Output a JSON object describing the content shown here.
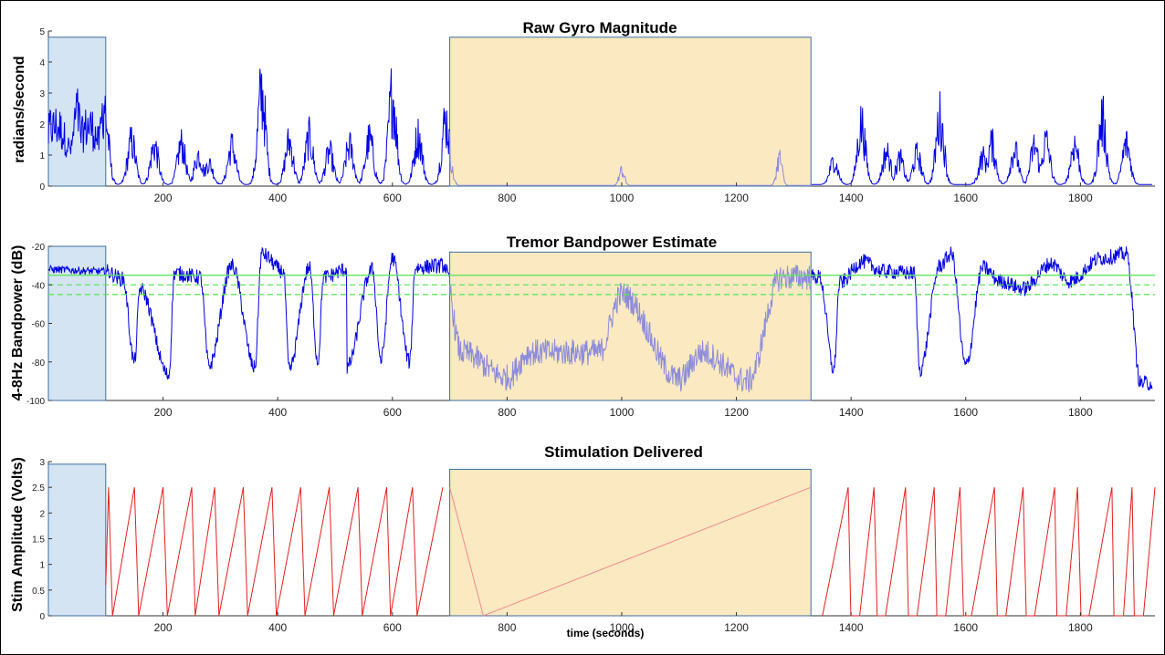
{
  "chart_data": [
    {
      "type": "line",
      "title": "Raw Gyro Magnitude",
      "xlabel": "",
      "ylabel": "radians/second",
      "xlim": [
        0,
        1930
      ],
      "ylim": [
        0,
        5
      ],
      "xticks": [
        200,
        400,
        600,
        800,
        1000,
        1200,
        1400,
        1600,
        1800
      ],
      "yticks": [
        0,
        1,
        2,
        3,
        4,
        5
      ],
      "line_color": "#0000e6",
      "shaded_regions": [
        {
          "x": [
            0,
            100
          ],
          "y": [
            0,
            4.8
          ],
          "color": "#d5e4f2"
        },
        {
          "x": [
            700,
            1330
          ],
          "y": [
            0,
            4.8
          ],
          "color": "#fbe9c1"
        }
      ],
      "peaks": [
        {
          "x": 5,
          "y": 2.2
        },
        {
          "x": 50,
          "y": 2.8
        },
        {
          "x": 98,
          "y": 3.3
        },
        {
          "x": 145,
          "y": 2.0
        },
        {
          "x": 185,
          "y": 1.8
        },
        {
          "x": 232,
          "y": 1.9
        },
        {
          "x": 262,
          "y": 1.4
        },
        {
          "x": 280,
          "y": 1.0
        },
        {
          "x": 320,
          "y": 1.8
        },
        {
          "x": 372,
          "y": 4.3
        },
        {
          "x": 420,
          "y": 2.0
        },
        {
          "x": 455,
          "y": 2.2
        },
        {
          "x": 490,
          "y": 1.5
        },
        {
          "x": 525,
          "y": 1.8
        },
        {
          "x": 560,
          "y": 2.1
        },
        {
          "x": 600,
          "y": 4.2
        },
        {
          "x": 645,
          "y": 2.3
        },
        {
          "x": 693,
          "y": 3.0
        },
        {
          "x": 1000,
          "y": 0.7
        },
        {
          "x": 1275,
          "y": 1.3
        },
        {
          "x": 1370,
          "y": 1.1
        },
        {
          "x": 1418,
          "y": 2.8
        },
        {
          "x": 1462,
          "y": 1.5
        },
        {
          "x": 1485,
          "y": 1.2
        },
        {
          "x": 1515,
          "y": 1.4
        },
        {
          "x": 1555,
          "y": 3.1
        },
        {
          "x": 1630,
          "y": 1.3
        },
        {
          "x": 1645,
          "y": 1.9
        },
        {
          "x": 1685,
          "y": 1.6
        },
        {
          "x": 1720,
          "y": 1.8
        },
        {
          "x": 1740,
          "y": 2.0
        },
        {
          "x": 1790,
          "y": 1.9
        },
        {
          "x": 1838,
          "y": 3.0
        },
        {
          "x": 1880,
          "y": 1.9
        }
      ]
    },
    {
      "type": "line",
      "title": "Tremor Bandpower Estimate",
      "xlabel": "",
      "ylabel": "4-8Hz Bandpower (dB)",
      "xlim": [
        0,
        1930
      ],
      "ylim": [
        -100,
        -20
      ],
      "xticks": [
        200,
        400,
        600,
        800,
        1000,
        1200,
        1400,
        1600,
        1800
      ],
      "yticks": [
        -100,
        -80,
        -60,
        -40,
        -20
      ],
      "line_color": "#0000e6",
      "threshold_lines": [
        {
          "y": -35,
          "style": "solid",
          "color": "#5ee65e"
        },
        {
          "y": -40,
          "style": "dashed",
          "color": "#5ee65e"
        },
        {
          "y": -45,
          "style": "dashed",
          "color": "#5ee65e"
        }
      ],
      "shaded_regions": [
        {
          "x": [
            0,
            100
          ],
          "y": [
            -100,
            -20
          ],
          "color": "#d5e4f2"
        },
        {
          "x": [
            700,
            1330
          ],
          "y": [
            -100,
            -23
          ],
          "color": "#fbe9c1"
        }
      ],
      "peaks": [
        {
          "x": 0,
          "y": -32
        },
        {
          "x": 100,
          "y": -33
        },
        {
          "x": 130,
          "y": -37
        },
        {
          "x": 160,
          "y": -42
        },
        {
          "x": 220,
          "y": -34
        },
        {
          "x": 265,
          "y": -36
        },
        {
          "x": 320,
          "y": -30
        },
        {
          "x": 372,
          "y": -24
        },
        {
          "x": 410,
          "y": -33
        },
        {
          "x": 455,
          "y": -31
        },
        {
          "x": 480,
          "y": -36
        },
        {
          "x": 520,
          "y": -32
        },
        {
          "x": 565,
          "y": -32
        },
        {
          "x": 600,
          "y": -26
        },
        {
          "x": 640,
          "y": -31
        },
        {
          "x": 690,
          "y": -30
        },
        {
          "x": 1000,
          "y": -45
        },
        {
          "x": 1278,
          "y": -36
        },
        {
          "x": 1345,
          "y": -36
        },
        {
          "x": 1380,
          "y": -39
        },
        {
          "x": 1420,
          "y": -28
        },
        {
          "x": 1455,
          "y": -33
        },
        {
          "x": 1510,
          "y": -34
        },
        {
          "x": 1555,
          "y": -30
        },
        {
          "x": 1575,
          "y": -24
        },
        {
          "x": 1630,
          "y": -31
        },
        {
          "x": 1660,
          "y": -38
        },
        {
          "x": 1700,
          "y": -42
        },
        {
          "x": 1750,
          "y": -29
        },
        {
          "x": 1780,
          "y": -38
        },
        {
          "x": 1838,
          "y": -26
        },
        {
          "x": 1880,
          "y": -24
        }
      ],
      "troughs": [
        {
          "x": 150,
          "y": -80
        },
        {
          "x": 210,
          "y": -87
        },
        {
          "x": 280,
          "y": -82
        },
        {
          "x": 360,
          "y": -83
        },
        {
          "x": 420,
          "y": -84
        },
        {
          "x": 470,
          "y": -80
        },
        {
          "x": 520,
          "y": -83
        },
        {
          "x": 580,
          "y": -79
        },
        {
          "x": 630,
          "y": -80
        },
        {
          "x": 800,
          "y": -88
        },
        {
          "x": 1100,
          "y": -89
        },
        {
          "x": 1220,
          "y": -90
        },
        {
          "x": 1370,
          "y": -84
        },
        {
          "x": 1520,
          "y": -84
        },
        {
          "x": 1600,
          "y": -82
        },
        {
          "x": 1905,
          "y": -91
        }
      ]
    },
    {
      "type": "line",
      "title": "Stimulation Delivered",
      "xlabel": "time (seconds)",
      "ylabel": "Stim Amplitude (Volts)",
      "xlim": [
        0,
        1930
      ],
      "ylim": [
        0,
        3
      ],
      "xticks": [
        200,
        400,
        600,
        800,
        1000,
        1200,
        1400,
        1600,
        1800
      ],
      "yticks": [
        0,
        0.5,
        1,
        1.5,
        2,
        2.5,
        3
      ],
      "line_color": "#e61e1e",
      "shaded_regions": [
        {
          "x": [
            0,
            100
          ],
          "y": [
            0,
            2.95
          ],
          "color": "#d5e4f2"
        },
        {
          "x": [
            700,
            1330
          ],
          "y": [
            0,
            2.85
          ],
          "color": "#fbe9c1"
        }
      ],
      "hold_level": {
        "x": [
          700,
          1330
        ],
        "y": 2.5
      },
      "peaks_x": [
        105,
        150,
        200,
        250,
        290,
        340,
        390,
        440,
        490,
        540,
        590,
        635,
        688,
        1395,
        1440,
        1495,
        1545,
        1590,
        1650,
        1700,
        1755,
        1795,
        1855,
        1890,
        1930
      ]
    }
  ]
}
